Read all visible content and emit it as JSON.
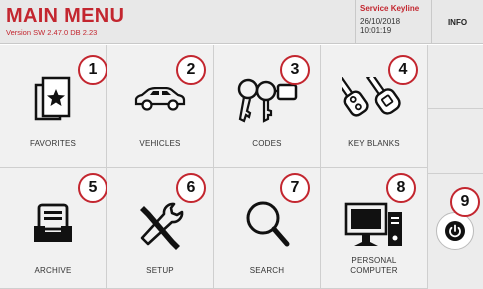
{
  "header": {
    "title": "MAIN MENU",
    "version": "Version SW 2.47.0 DB 2.23",
    "service_title": "Service Keyline",
    "date": "26/10/2018",
    "time": "10:01:19",
    "info_label": "INFO"
  },
  "tiles": [
    {
      "label": "FAVORITES",
      "badge": "1",
      "icon": "star-cards-icon"
    },
    {
      "label": "VEHICLES",
      "badge": "2",
      "icon": "car-icon"
    },
    {
      "label": "CODES",
      "badge": "3",
      "icon": "keys-icon"
    },
    {
      "label": "KEY BLANKS",
      "badge": "4",
      "icon": "key-blanks-icon"
    },
    {
      "label": "ARCHIVE",
      "badge": "5",
      "icon": "archive-tray-icon"
    },
    {
      "label": "SETUP",
      "badge": "6",
      "icon": "tools-icon"
    },
    {
      "label": "SEARCH",
      "badge": "7",
      "icon": "magnifier-icon"
    },
    {
      "label_line1": "PERSONAL",
      "label_line2": "COMPUTER",
      "badge": "8",
      "icon": "computer-icon"
    }
  ],
  "power": {
    "badge": "9",
    "icon": "power-icon"
  },
  "colors": {
    "accent": "#c3262f",
    "tile_bg": "#f1f1f1",
    "header_bg": "#e8e8e8"
  }
}
